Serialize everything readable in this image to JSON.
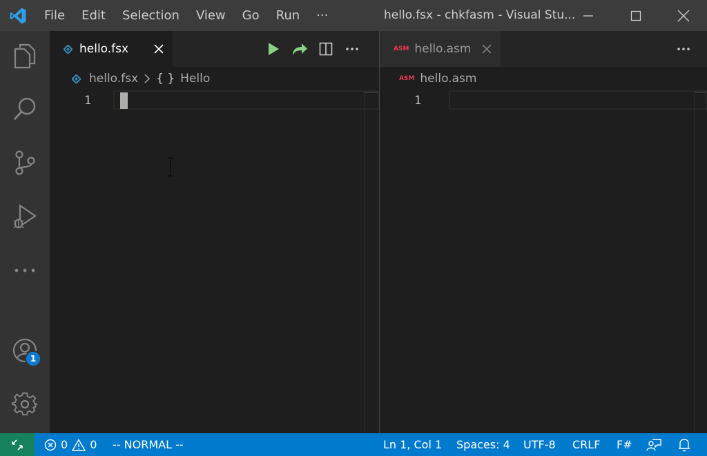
{
  "titlebar": {
    "menu": [
      "File",
      "Edit",
      "Selection",
      "View",
      "Go",
      "Run",
      "···"
    ],
    "window_title": "hello.fsx - chkfasm - Visual Stu..."
  },
  "activitybar": {
    "items": [
      "explorer-icon",
      "search-icon",
      "source-control-icon",
      "run-debug-icon",
      "more-icon"
    ],
    "bottom": [
      "accounts-icon",
      "manage-gear-icon"
    ],
    "accounts_badge": "1"
  },
  "left_group": {
    "tab_label": "hello.fsx",
    "breadcrumb_file": "hello.fsx",
    "breadcrumb_symbol_glyph": "{ }",
    "breadcrumb_symbol": "Hello",
    "line_number": "1",
    "actions": [
      "run-icon",
      "send-to-interactive-icon",
      "split-editor-icon",
      "more-actions-icon"
    ]
  },
  "right_group": {
    "tab_label": "hello.asm",
    "file_icon_text": "ASM",
    "breadcrumb_file": "hello.asm",
    "line_number": "1",
    "actions": [
      "more-actions-icon"
    ]
  },
  "statusbar": {
    "errors": "0",
    "warnings": "0",
    "mode": "-- NORMAL --",
    "position": "Ln 1, Col 1",
    "spaces": "Spaces: 4",
    "encoding": "UTF-8",
    "eol": "CRLF",
    "language": "F#"
  },
  "colors": {
    "accent": "#007acc",
    "remote": "#16825d",
    "fsharp_icon": "#378bba",
    "asm_icon": "#e8384f",
    "run_green": "#89d185"
  }
}
